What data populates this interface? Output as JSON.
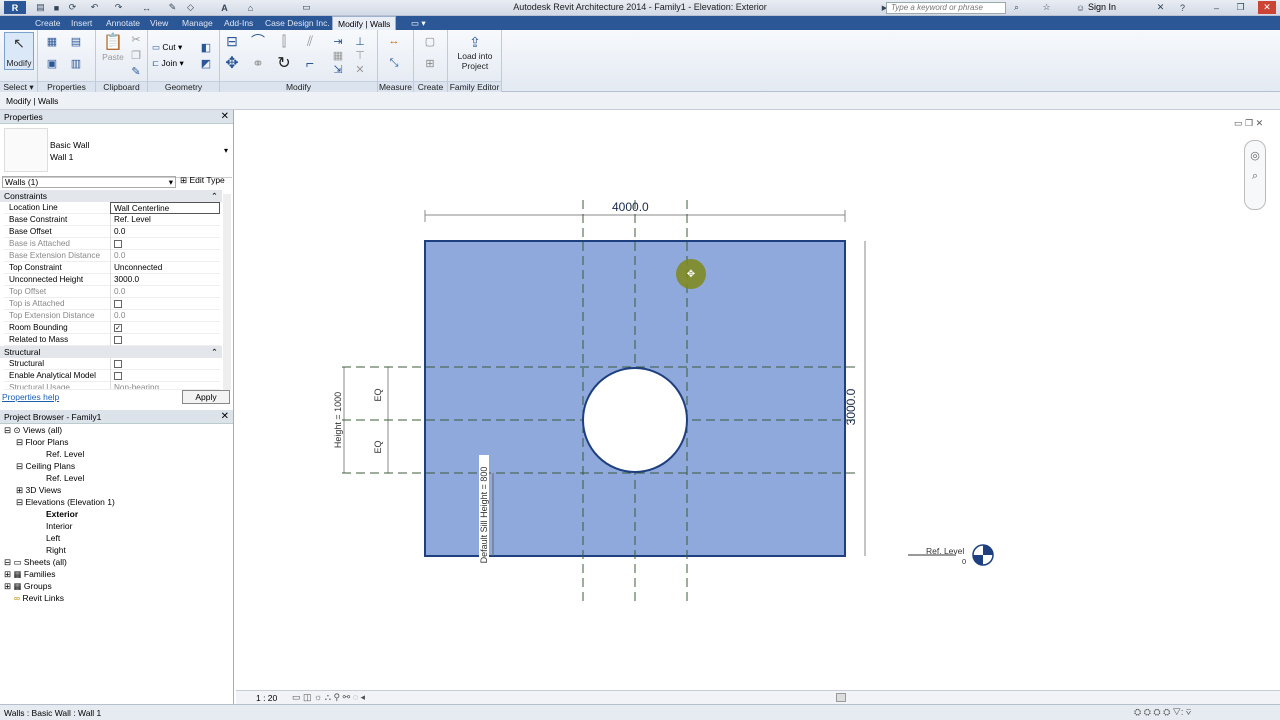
{
  "app": {
    "title": "Autodesk Revit Architecture 2014 -   Family1 - Elevation: Exterior",
    "search_placeholder": "Type a keyword or phrase",
    "sign_in": "Sign In"
  },
  "tabs": [
    "Create",
    "Insert",
    "Annotate",
    "View",
    "Manage",
    "Add-Ins",
    "Case Design Inc.",
    "Modify | Walls"
  ],
  "ribbon": {
    "modify_label": "Modify",
    "paste_label": "Paste",
    "cut_label": "Cut",
    "join_label": "Join",
    "load_into_project_line1": "Load into",
    "load_into_project_line2": "Project",
    "panels": [
      "Select",
      "Properties",
      "Clipboard",
      "Geometry",
      "Modify",
      "Measure",
      "Create",
      "Family Editor"
    ]
  },
  "context_bar": "Modify | Walls",
  "properties": {
    "title": "Properties",
    "type_family": "Basic Wall",
    "type_name": "Wall 1",
    "selector": "Walls (1)",
    "edit_type": "Edit Type",
    "sections": [
      "Constraints",
      "Structural"
    ],
    "rows": [
      {
        "k": "Location Line",
        "v": "Wall Centerline"
      },
      {
        "k": "Base Constraint",
        "v": "Ref. Level"
      },
      {
        "k": "Base Offset",
        "v": "0.0"
      },
      {
        "k": "Base is Attached",
        "v": ""
      },
      {
        "k": "Base Extension Distance",
        "v": "0.0"
      },
      {
        "k": "Top Constraint",
        "v": "Unconnected"
      },
      {
        "k": "Unconnected Height",
        "v": "3000.0"
      },
      {
        "k": "Top Offset",
        "v": "0.0"
      },
      {
        "k": "Top is Attached",
        "v": ""
      },
      {
        "k": "Top Extension Distance",
        "v": "0.0"
      },
      {
        "k": "Room Bounding",
        "v": "✓"
      },
      {
        "k": "Related to Mass",
        "v": ""
      },
      {
        "k": "Structural",
        "v": ""
      },
      {
        "k": "Enable Analytical Model",
        "v": ""
      },
      {
        "k": "Structural Usage",
        "v": "Non-bearing"
      }
    ],
    "help": "Properties help",
    "apply": "Apply"
  },
  "browser": {
    "title": "Project Browser - Family1",
    "nodes": [
      "Views (all)",
      "Floor Plans",
      "Ref. Level",
      "Ceiling Plans",
      "Ref. Level",
      "3D Views",
      "Elevations (Elevation 1)",
      "Exterior",
      "Interior",
      "Left",
      "Right",
      "Sheets (all)",
      "Families",
      "Groups",
      "Revit Links"
    ]
  },
  "canvas": {
    "dim_width": "4000.0",
    "dim_height": "3000.0",
    "dim_opening_height": "Height = 1000",
    "eq_top": "EQ",
    "eq_bottom": "EQ",
    "sill_height": "Default Sill Height = 800",
    "level_name": "Ref. Level",
    "level_value": "0",
    "wall_color": "#8fa9dc",
    "accent_color": "#2b5797"
  },
  "view_bar": {
    "scale": "1 : 20"
  },
  "status_bar": "Walls : Basic Wall : Wall 1"
}
